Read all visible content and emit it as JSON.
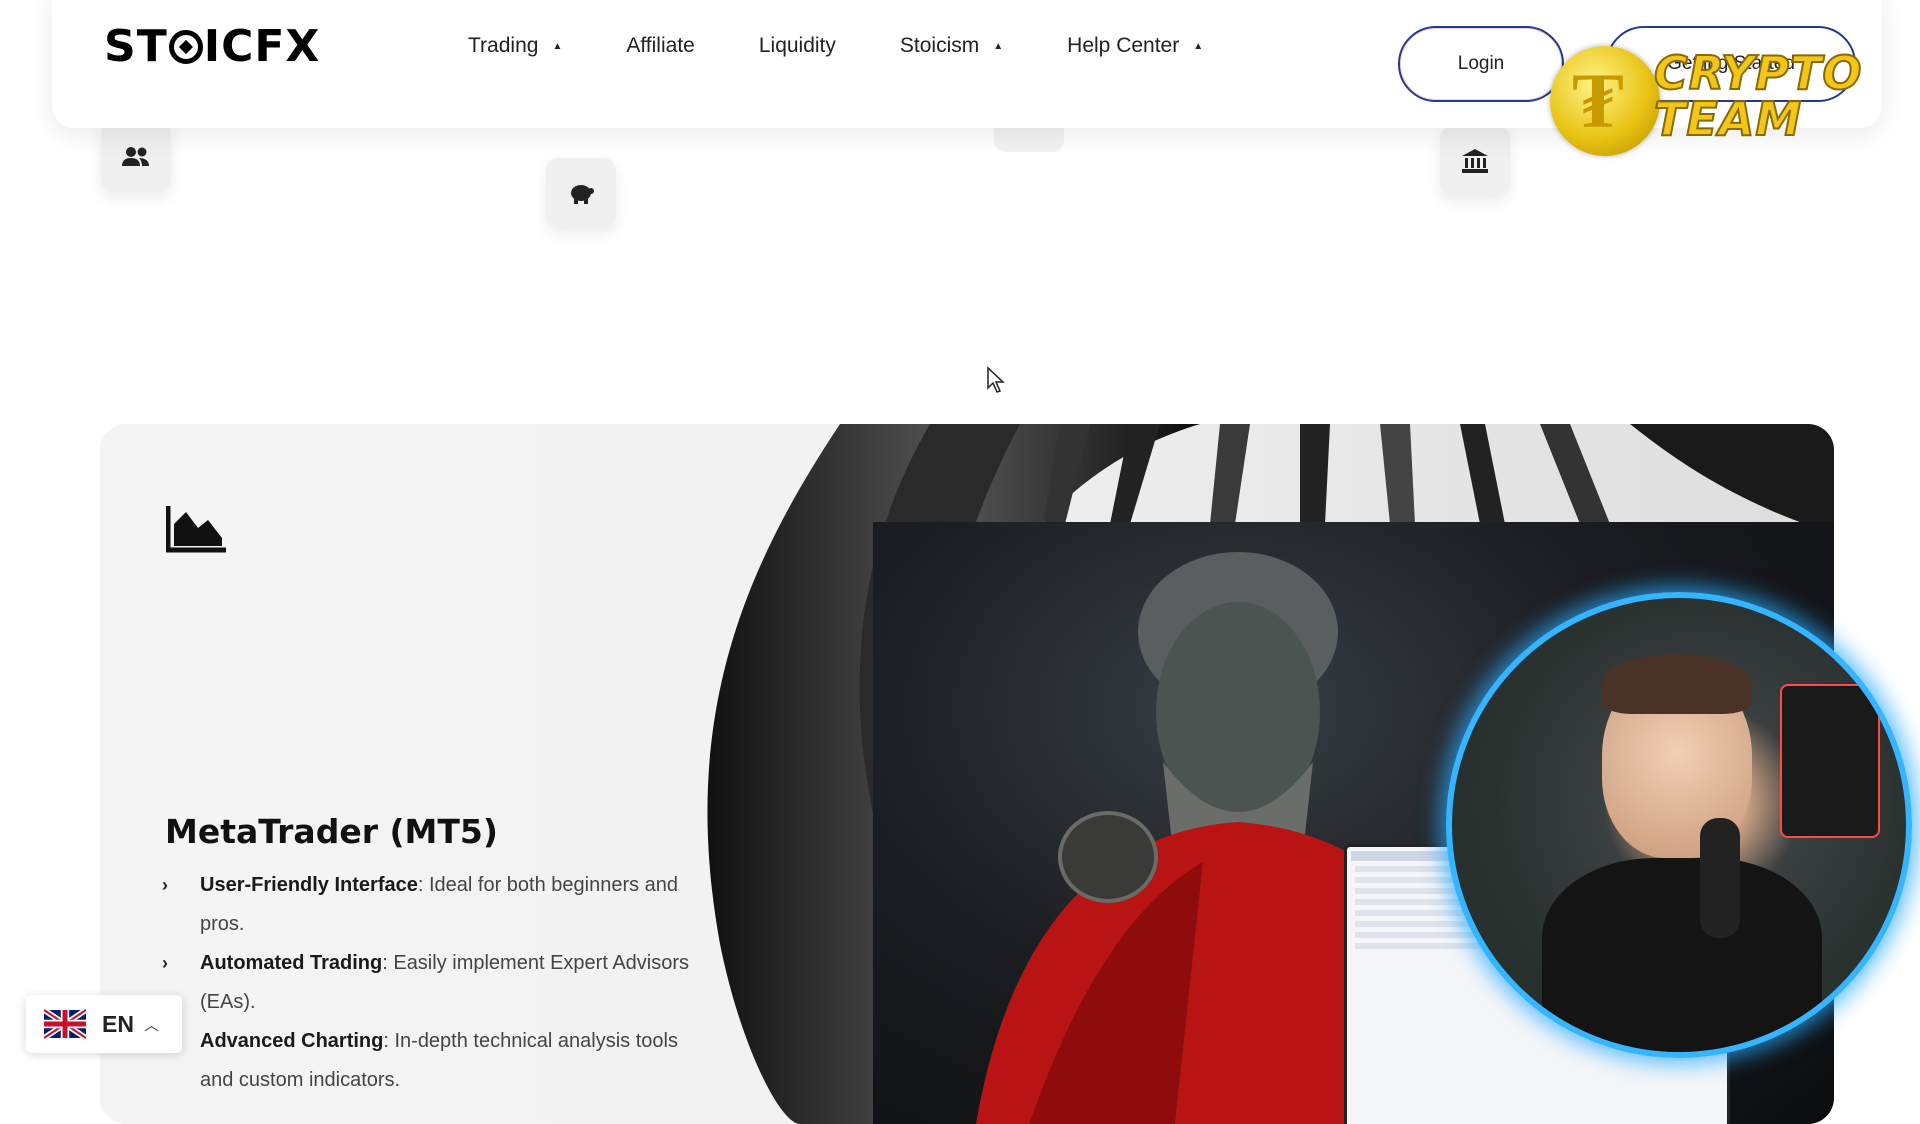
{
  "header": {
    "logo_text": "STOICFX",
    "nav": [
      {
        "label": "Trading",
        "has_dropdown": true
      },
      {
        "label": "Affiliate",
        "has_dropdown": false
      },
      {
        "label": "Liquidity",
        "has_dropdown": false
      },
      {
        "label": "Stoicism",
        "has_dropdown": true
      },
      {
        "label": "Help Center",
        "has_dropdown": true
      }
    ],
    "login_label": "Login",
    "getting_started_label": "Getting Started"
  },
  "overlay": {
    "crypto_team_line1": "CRYPTO",
    "crypto_team_line2": "TEAM"
  },
  "tiles": [
    {
      "icon": "users-icon"
    },
    {
      "icon": "piggy-bank-icon"
    },
    {
      "icon": "bank-icon"
    }
  ],
  "card": {
    "icon": "area-chart-icon",
    "title": "MetaTrader (MT5)",
    "features": [
      {
        "bold": "User-Friendly Interface",
        "text": ": Ideal for both beginners and pros."
      },
      {
        "bold": "Automated Trading",
        "text": ": Easily implement Expert Advisors (EAs)."
      },
      {
        "bold": "Advanced Charting",
        "text": ": In-depth technical analysis tools and custom indicators."
      }
    ]
  },
  "language": {
    "code": "EN",
    "flag": "uk-flag-icon"
  },
  "colors": {
    "button_border": "#243a8f",
    "webcam_ring": "#35b4ff",
    "crypto_gold": "#f3c61a"
  }
}
